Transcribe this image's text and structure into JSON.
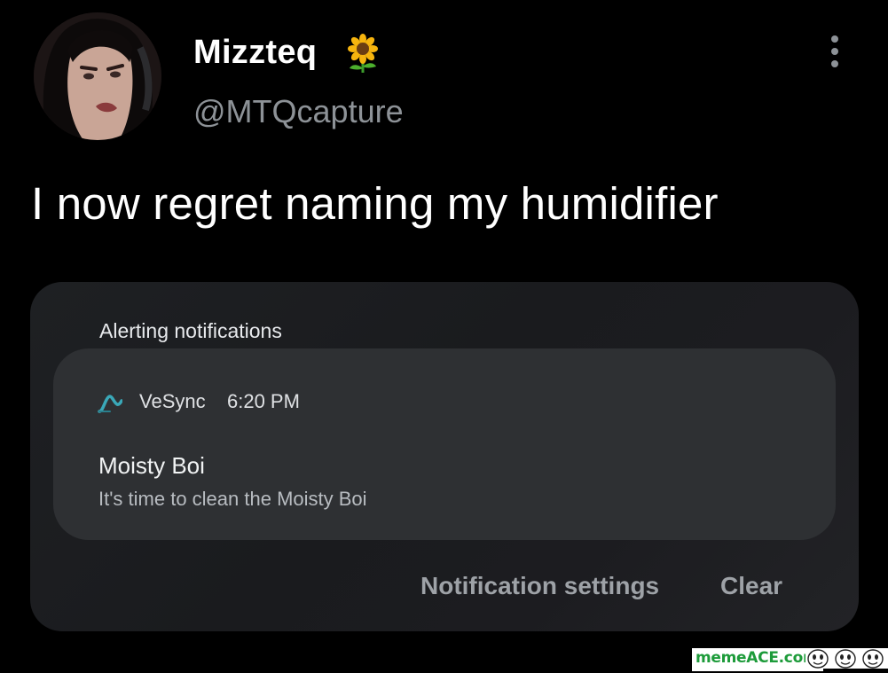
{
  "tweet": {
    "display_name": "Mizzteq",
    "name_emoji": "sunflower-icon",
    "handle": "@MTQcapture",
    "text": "I now regret naming my humidifier"
  },
  "notification_panel": {
    "header": "Alerting notifications",
    "notification": {
      "app_name": "VeSync",
      "time": "6:20 PM",
      "title": "Moisty Boi",
      "body": "It's time to clean the Moisty Boi"
    },
    "settings_label": "Notification settings",
    "clear_label": "Clear"
  },
  "watermark": {
    "text": "memeACE.com"
  },
  "colors": {
    "background": "#000000",
    "panel": "#1d1e21",
    "card": "#2e3033",
    "muted_text": "#8d9297",
    "watermark_green": "#1d9b3a"
  }
}
